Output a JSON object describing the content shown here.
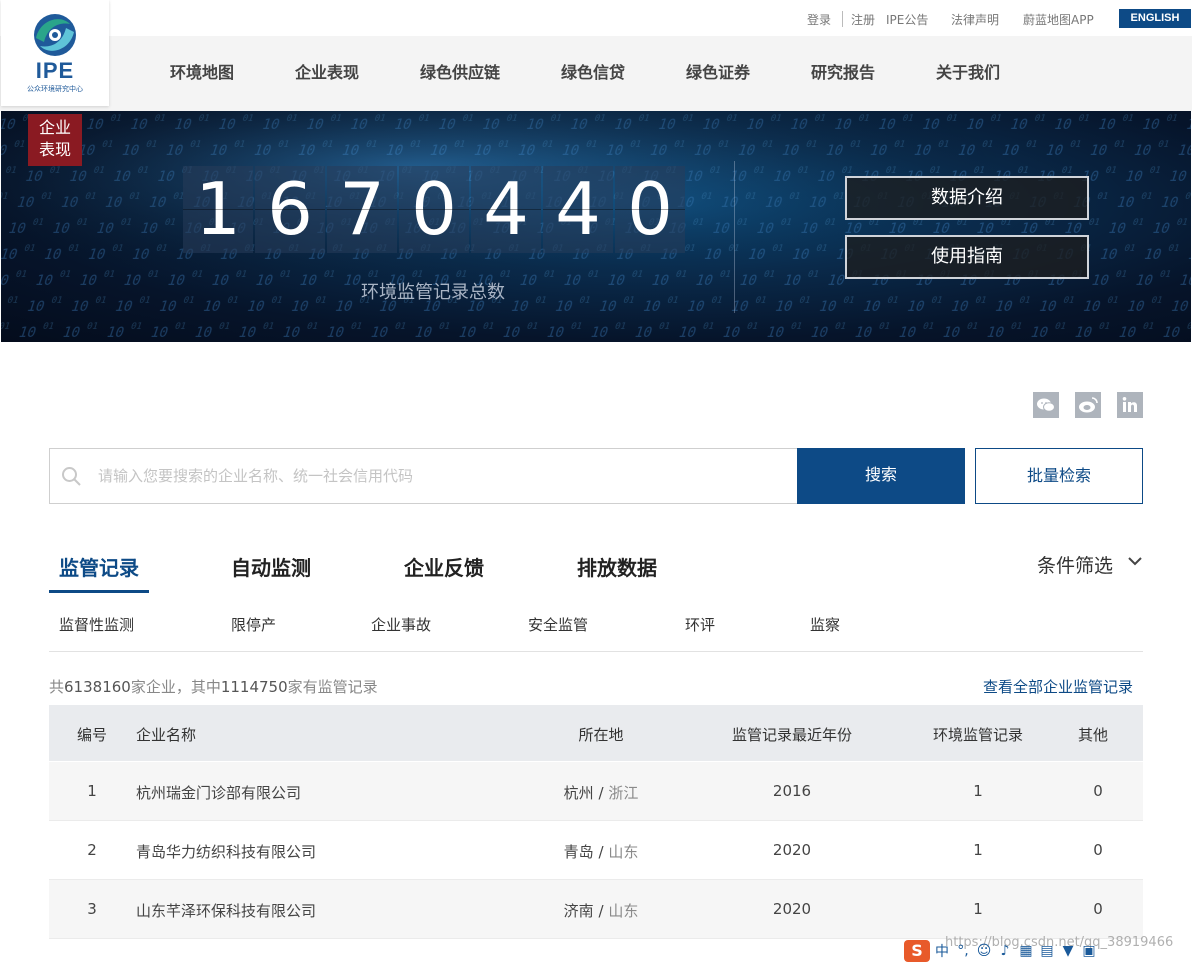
{
  "logo": {
    "text": "IPE",
    "subtitle": "公众环境研究中心"
  },
  "topbar": {
    "login": "登录",
    "register": "注册",
    "announcement": "IPE公告",
    "legal": "法律声明",
    "app": "蔚蓝地图APP",
    "english": "ENGLISH"
  },
  "nav": [
    "环境地图",
    "企业表现",
    "绿色供应链",
    "绿色信贷",
    "绿色证券",
    "研究报告",
    "关于我们"
  ],
  "banner": {
    "tag": "企业表现",
    "digits": [
      "1",
      "6",
      "7",
      "0",
      "4",
      "4",
      "0"
    ],
    "counter_label": "环境监管记录总数",
    "btn_intro": "数据介绍",
    "btn_guide": "使用指南"
  },
  "share": {
    "wechat": "wechat-icon",
    "weibo": "weibo-icon",
    "linkedin": "linkedin-icon"
  },
  "search": {
    "placeholder": "请输入您要搜索的企业名称、统一社会信用代码",
    "value": "",
    "button": "搜索",
    "batch": "批量检索"
  },
  "tabs": [
    "监管记录",
    "自动监测",
    "企业反馈",
    "排放数据"
  ],
  "filter": "条件筛选",
  "subtabs": [
    "监督性监测",
    "限停产",
    "企业事故",
    "安全监管",
    "环评",
    "监察"
  ],
  "summary": {
    "prefix": "共",
    "total": "6138160",
    "mid": "家企业，其中",
    "with_records": "1114750",
    "suffix": "家有监管记录"
  },
  "view_all": "查看全部企业监管记录",
  "table": {
    "headers": [
      "编号",
      "企业名称",
      "所在地",
      "监管记录最近年份",
      "环境监管记录",
      "其他"
    ],
    "rows": [
      {
        "no": "1",
        "name": "杭州瑞金门诊部有限公司",
        "city": "杭州",
        "province": "浙江",
        "year": "2016",
        "records": "1",
        "other": "0"
      },
      {
        "no": "2",
        "name": "青岛华力纺织科技有限公司",
        "city": "青岛",
        "province": "山东",
        "year": "2020",
        "records": "1",
        "other": "0"
      },
      {
        "no": "3",
        "name": "山东芊泽环保科技有限公司",
        "city": "济南",
        "province": "山东",
        "year": "2020",
        "records": "1",
        "other": "0"
      }
    ],
    "sep": "/"
  },
  "ime": {
    "label": "中"
  },
  "watermark": "https://blog.csdn.net/qq_38919466",
  "colors": {
    "primary": "#0d4a86",
    "tag": "#8a1a22",
    "ime": "#e85a2a"
  }
}
